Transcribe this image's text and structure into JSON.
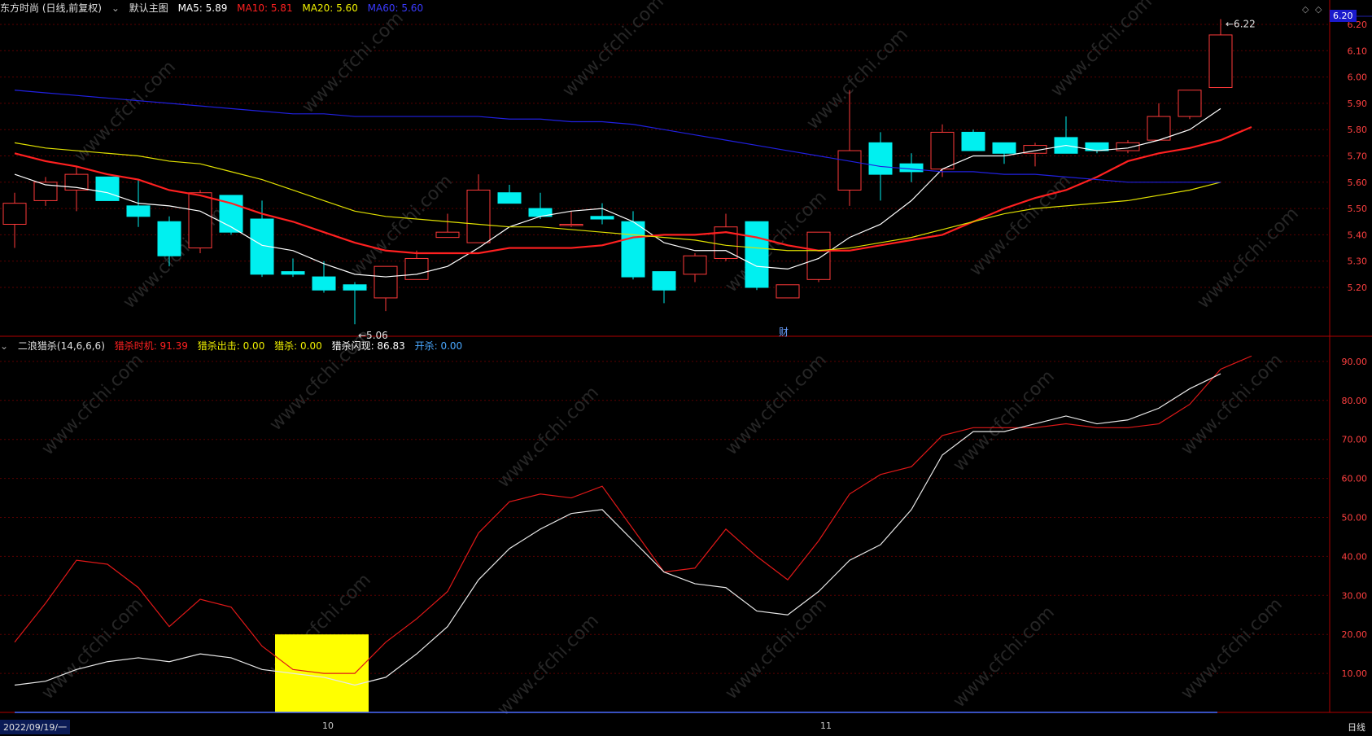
{
  "header": {
    "stock_label": "东方时尚 (日线,前复权)",
    "main_chart_label": "默认主图",
    "ma": [
      {
        "label": "MA5: 5.89",
        "color": "#ffffff"
      },
      {
        "label": "MA10: 5.81",
        "color": "#ff2020"
      },
      {
        "label": "MA20: 5.60",
        "color": "#f0f000"
      },
      {
        "label": "MA60: 5.60",
        "color": "#2020ff"
      }
    ]
  },
  "indicator": {
    "label": "二浪猎杀(14,6,6,6)",
    "values": [
      {
        "label": "猎杀时机: 91.39",
        "color": "#ff2020"
      },
      {
        "label": "猎杀出击: 0.00",
        "color": "#f0f000"
      },
      {
        "label": "猎杀: 0.00",
        "color": "#f0f000"
      },
      {
        "label": "猎杀闪现: 86.83",
        "color": "#ffffff"
      },
      {
        "label": "开杀: 0.00",
        "color": "#4aa8ff"
      }
    ]
  },
  "right_tag": "6.20",
  "footer": {
    "start_date": "2022/09/19/一",
    "months": [
      "10",
      "11"
    ],
    "period": "日线"
  },
  "annotations": {
    "low": "5.06",
    "high": "6.22",
    "event": "财"
  },
  "watermark": "www.cfchi.com",
  "colors": {
    "up": "#ff3a3a",
    "down": "#00f0f0",
    "ma5": "#ffffff",
    "ma10": "#ff2020",
    "ma20": "#e0e000",
    "ma60": "#2020e0",
    "grid": "#5a0000",
    "axis": "#b00000",
    "bar": "#ffff00",
    "line": "#4a6aff"
  },
  "chart_data": [
    {
      "type": "candlestick",
      "yticks": [
        "6.20",
        "6.10",
        "6.00",
        "5.90",
        "5.80",
        "5.70",
        "5.60",
        "5.50",
        "5.40",
        "5.30",
        "5.20"
      ],
      "ylim": [
        5.06,
        6.22
      ],
      "candles": [
        {
          "o": 5.44,
          "h": 5.56,
          "l": 5.35,
          "c": 5.52
        },
        {
          "o": 5.53,
          "h": 5.62,
          "l": 5.51,
          "c": 5.6
        },
        {
          "o": 5.57,
          "h": 5.66,
          "l": 5.49,
          "c": 5.63
        },
        {
          "o": 5.62,
          "h": 5.62,
          "l": 5.53,
          "c": 5.53
        },
        {
          "o": 5.51,
          "h": 5.61,
          "l": 5.43,
          "c": 5.47
        },
        {
          "o": 5.45,
          "h": 5.47,
          "l": 5.28,
          "c": 5.32
        },
        {
          "o": 5.35,
          "h": 5.57,
          "l": 5.33,
          "c": 5.56
        },
        {
          "o": 5.55,
          "h": 5.55,
          "l": 5.4,
          "c": 5.41
        },
        {
          "o": 5.46,
          "h": 5.53,
          "l": 5.24,
          "c": 5.25
        },
        {
          "o": 5.26,
          "h": 5.31,
          "l": 5.24,
          "c": 5.25
        },
        {
          "o": 5.24,
          "h": 5.3,
          "l": 5.18,
          "c": 5.19
        },
        {
          "o": 5.21,
          "h": 5.22,
          "l": 5.06,
          "c": 5.19
        },
        {
          "o": 5.16,
          "h": 5.28,
          "l": 5.11,
          "c": 5.28
        },
        {
          "o": 5.23,
          "h": 5.34,
          "l": 5.23,
          "c": 5.31
        },
        {
          "o": 5.39,
          "h": 5.48,
          "l": 5.39,
          "c": 5.41
        },
        {
          "o": 5.37,
          "h": 5.63,
          "l": 5.37,
          "c": 5.57
        },
        {
          "o": 5.56,
          "h": 5.59,
          "l": 5.52,
          "c": 5.52
        },
        {
          "o": 5.5,
          "h": 5.56,
          "l": 5.46,
          "c": 5.47
        },
        {
          "o": 5.44,
          "h": 5.49,
          "l": 5.43,
          "c": 5.44
        },
        {
          "o": 5.47,
          "h": 5.52,
          "l": 5.44,
          "c": 5.46
        },
        {
          "o": 5.45,
          "h": 5.49,
          "l": 5.23,
          "c": 5.24
        },
        {
          "o": 5.26,
          "h": 5.26,
          "l": 5.14,
          "c": 5.19
        },
        {
          "o": 5.25,
          "h": 5.33,
          "l": 5.22,
          "c": 5.32
        },
        {
          "o": 5.31,
          "h": 5.48,
          "l": 5.3,
          "c": 5.43
        },
        {
          "o": 5.45,
          "h": 5.45,
          "l": 5.19,
          "c": 5.2
        },
        {
          "o": 5.16,
          "h": 5.21,
          "l": 5.16,
          "c": 5.21
        },
        {
          "o": 5.23,
          "h": 5.41,
          "l": 5.22,
          "c": 5.41
        },
        {
          "o": 5.57,
          "h": 5.95,
          "l": 5.51,
          "c": 5.72
        },
        {
          "o": 5.75,
          "h": 5.79,
          "l": 5.53,
          "c": 5.63
        },
        {
          "o": 5.67,
          "h": 5.71,
          "l": 5.6,
          "c": 5.64
        },
        {
          "o": 5.65,
          "h": 5.82,
          "l": 5.62,
          "c": 5.79
        },
        {
          "o": 5.79,
          "h": 5.8,
          "l": 5.72,
          "c": 5.72
        },
        {
          "o": 5.75,
          "h": 5.75,
          "l": 5.67,
          "c": 5.71
        },
        {
          "o": 5.71,
          "h": 5.75,
          "l": 5.66,
          "c": 5.74
        },
        {
          "o": 5.77,
          "h": 5.85,
          "l": 5.71,
          "c": 5.71
        },
        {
          "o": 5.75,
          "h": 5.75,
          "l": 5.71,
          "c": 5.72
        },
        {
          "o": 5.72,
          "h": 5.76,
          "l": 5.71,
          "c": 5.75
        },
        {
          "o": 5.76,
          "h": 5.9,
          "l": 5.76,
          "c": 5.85
        },
        {
          "o": 5.85,
          "h": 5.95,
          "l": 5.84,
          "c": 5.95
        },
        {
          "o": 5.96,
          "h": 6.22,
          "l": 5.96,
          "c": 6.16
        }
      ],
      "series": [
        {
          "name": "MA5",
          "values": [
            5.63,
            5.59,
            5.58,
            5.56,
            5.52,
            5.51,
            5.49,
            5.43,
            5.36,
            5.34,
            5.29,
            5.25,
            5.24,
            5.25,
            5.28,
            5.35,
            5.43,
            5.47,
            5.49,
            5.5,
            5.45,
            5.37,
            5.34,
            5.34,
            5.28,
            5.27,
            5.31,
            5.39,
            5.44,
            5.53,
            5.65,
            5.7,
            5.7,
            5.72,
            5.74,
            5.72,
            5.73,
            5.76,
            5.8,
            5.88
          ]
        },
        {
          "name": "MA10",
          "values": [
            5.71,
            5.68,
            5.66,
            5.63,
            5.61,
            5.57,
            5.55,
            5.52,
            5.48,
            5.45,
            5.41,
            5.37,
            5.34,
            5.33,
            5.33,
            5.33,
            5.35,
            5.35,
            5.35,
            5.36,
            5.39,
            5.4,
            5.4,
            5.41,
            5.39,
            5.36,
            5.34,
            5.34,
            5.36,
            5.38,
            5.4,
            5.45,
            5.5,
            5.54,
            5.57,
            5.62,
            5.68,
            5.71,
            5.73,
            5.76,
            5.81
          ]
        },
        {
          "name": "MA20",
          "values": [
            5.75,
            5.73,
            5.72,
            5.71,
            5.7,
            5.68,
            5.67,
            5.64,
            5.61,
            5.57,
            5.53,
            5.49,
            5.47,
            5.46,
            5.45,
            5.44,
            5.43,
            5.43,
            5.42,
            5.41,
            5.4,
            5.39,
            5.38,
            5.36,
            5.35,
            5.34,
            5.34,
            5.35,
            5.37,
            5.39,
            5.42,
            5.45,
            5.48,
            5.5,
            5.51,
            5.52,
            5.53,
            5.55,
            5.57,
            5.6
          ]
        },
        {
          "name": "MA60",
          "values": [
            5.95,
            5.94,
            5.93,
            5.92,
            5.91,
            5.9,
            5.89,
            5.88,
            5.87,
            5.86,
            5.86,
            5.85,
            5.85,
            5.85,
            5.85,
            5.85,
            5.84,
            5.84,
            5.83,
            5.83,
            5.82,
            5.8,
            5.78,
            5.76,
            5.74,
            5.72,
            5.7,
            5.68,
            5.66,
            5.65,
            5.64,
            5.64,
            5.63,
            5.63,
            5.62,
            5.61,
            5.6,
            5.6,
            5.6,
            5.6
          ]
        }
      ]
    },
    {
      "type": "line",
      "yticks": [
        "90.00",
        "80.00",
        "70.00",
        "60.00",
        "50.00",
        "40.00",
        "30.00",
        "20.00",
        "10.00"
      ],
      "ylim": [
        0,
        95
      ],
      "series": [
        {
          "name": "猎杀时机",
          "values": [
            18,
            28,
            39,
            38,
            32,
            22,
            29,
            27,
            17,
            11,
            10,
            10,
            18,
            24,
            31,
            46,
            54,
            56,
            55,
            58,
            47,
            36,
            37,
            47,
            40,
            34,
            44,
            56,
            61,
            63,
            71,
            73,
            73,
            73,
            74,
            73,
            73,
            74,
            79,
            88,
            91.39
          ]
        },
        {
          "name": "猎杀闪现",
          "values": [
            7,
            8,
            11,
            13,
            14,
            13,
            15,
            14,
            11,
            10,
            9,
            7,
            9,
            15,
            22,
            34,
            42,
            47,
            51,
            52,
            44,
            36,
            33,
            32,
            26,
            25,
            31,
            39,
            43,
            52,
            66,
            72,
            72,
            74,
            76,
            74,
            75,
            78,
            83,
            86.83
          ]
        },
        {
          "name": "开杀",
          "values": [
            0
          ]
        }
      ],
      "bars": [
        {
          "from": 9,
          "to": 11,
          "value": 20
        }
      ]
    }
  ]
}
